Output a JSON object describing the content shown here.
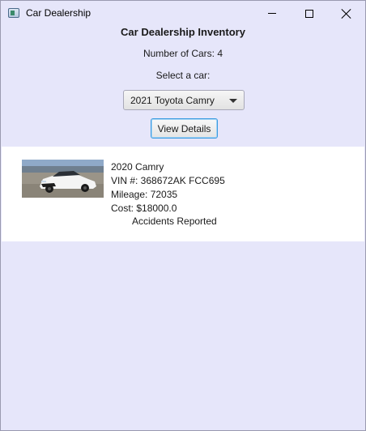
{
  "window": {
    "title": "Car Dealership"
  },
  "header": {
    "title": "Car Dealership Inventory",
    "car_count_text": "Number of Cars: 4",
    "select_label": "Select a car:"
  },
  "car_select": {
    "selected": "2021 Toyota Camry"
  },
  "view_button": {
    "label": "View Details"
  },
  "details": {
    "name": "2020 Camry",
    "vin": "VIN #: 368672AK FCC695",
    "mileage": "Mileage: 72035",
    "cost": "Cost: $18000.0",
    "accidents": "Accidents Reported"
  },
  "colors": {
    "background": "#e6e6fa",
    "panel": "#ffffff",
    "focus_border": "#3a9be0"
  }
}
